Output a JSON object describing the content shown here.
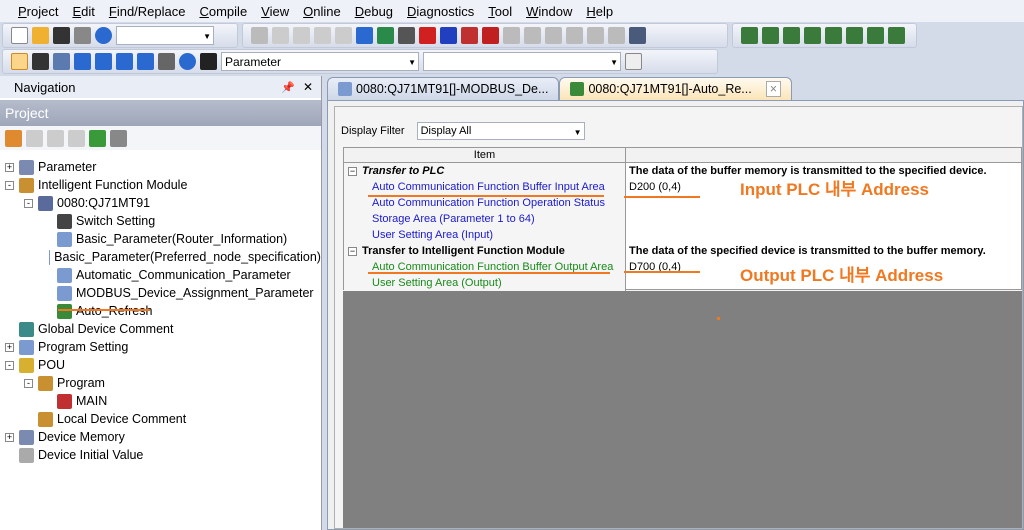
{
  "menu": [
    "Project",
    "Edit",
    "Find/Replace",
    "Compile",
    "View",
    "Online",
    "Debug",
    "Diagnostics",
    "Tool",
    "Window",
    "Help"
  ],
  "toolbar": {
    "search_combo": "",
    "parameter_combo": "Parameter"
  },
  "navigation": {
    "title": "Navigation",
    "project_header": "Project",
    "tree": [
      {
        "label": "Parameter",
        "level": 0,
        "exp": "+"
      },
      {
        "label": "Intelligent Function Module",
        "level": 0,
        "exp": "-"
      },
      {
        "label": "0080:QJ71MT91",
        "level": 1,
        "exp": "-"
      },
      {
        "label": "Switch Setting",
        "level": 2
      },
      {
        "label": "Basic_Parameter(Router_Information)",
        "level": 2
      },
      {
        "label": "Basic_Parameter(Preferred_node_specification)",
        "level": 2
      },
      {
        "label": "Automatic_Communication_Parameter",
        "level": 2
      },
      {
        "label": "MODBUS_Device_Assignment_Parameter",
        "level": 2
      },
      {
        "label": "Auto_Refresh",
        "level": 2
      },
      {
        "label": "Global Device Comment",
        "level": 0
      },
      {
        "label": "Program Setting",
        "level": 0,
        "exp": "+"
      },
      {
        "label": "POU",
        "level": 0,
        "exp": "-"
      },
      {
        "label": "Program",
        "level": 1,
        "exp": "-"
      },
      {
        "label": "MAIN",
        "level": 2
      },
      {
        "label": "Local Device Comment",
        "level": 1
      },
      {
        "label": "Device Memory",
        "level": 0,
        "exp": "+"
      },
      {
        "label": "Device Initial Value",
        "level": 0
      }
    ]
  },
  "tabs": [
    {
      "label": "0080:QJ71MT91[]-MODBUS_De..."
    },
    {
      "label": "0080:QJ71MT91[]-Auto_Re...",
      "close": "×"
    }
  ],
  "filter": {
    "label": "Display Filter",
    "value": "Display All"
  },
  "table": {
    "header": "Item",
    "rows": [
      {
        "item": "Transfer to PLC",
        "value": "The data of the buffer memory is transmitted to the specified device.",
        "type": "group-italic"
      },
      {
        "item": "Auto Communication Function Buffer Input Area",
        "value": "D200 (0,4)",
        "type": "blue"
      },
      {
        "item": "Auto Communication Function Operation Status",
        "value": "",
        "type": "blue"
      },
      {
        "item": "Storage Area (Parameter 1 to 64)",
        "value": "",
        "type": "blue"
      },
      {
        "item": "User Setting Area (Input)",
        "value": "",
        "type": "blue"
      },
      {
        "item": "Transfer to Intelligent Function Module",
        "value": "The data of the specified device is transmitted to the buffer memory.",
        "type": "group"
      },
      {
        "item": "Auto Communication Function Buffer Output Area",
        "value": "D700 (0,4)",
        "type": "green"
      },
      {
        "item": "User Setting Area (Output)",
        "value": "",
        "type": "green"
      }
    ]
  },
  "annotations": {
    "input": "Input PLC 내부 Address",
    "output": "Output PLC 내부 Address"
  },
  "colors": {
    "annotation": "#f07820",
    "blue_item": "#1a1acc",
    "green_item": "#1a8a1a"
  }
}
